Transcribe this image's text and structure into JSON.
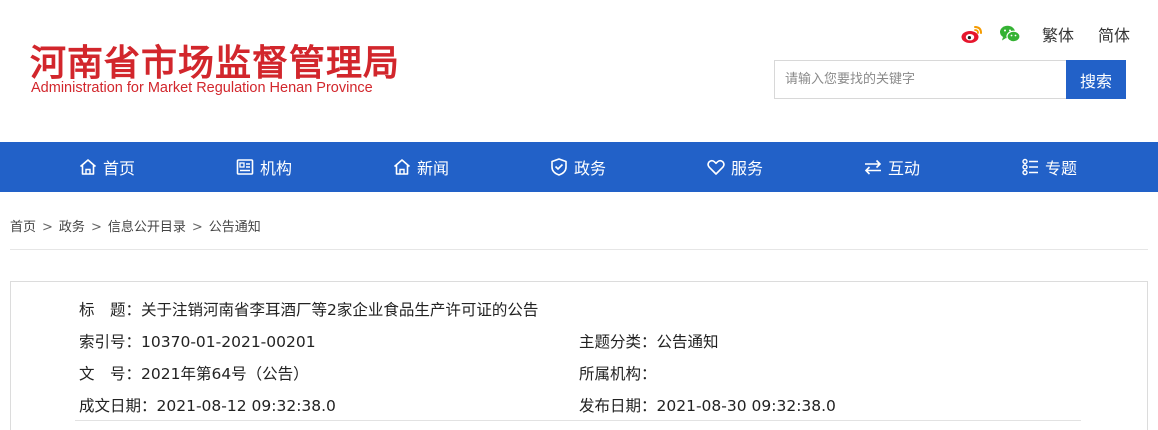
{
  "header": {
    "title": "河南省市场监督管理局",
    "subtitle": "Administration for Market Regulation Henan Province",
    "links": {
      "traditional": "繁体",
      "simplified": "简体"
    },
    "search": {
      "placeholder": "请输入您要找的关键字",
      "button": "搜索"
    },
    "icons": [
      "weibo-icon",
      "wechat-icon"
    ]
  },
  "colors": {
    "brand_red": "#d2262c",
    "nav_blue": "#2261c8"
  },
  "nav": {
    "items": [
      {
        "label": "首页",
        "icon": "home-icon"
      },
      {
        "label": "机构",
        "icon": "org-icon"
      },
      {
        "label": "新闻",
        "icon": "news-icon"
      },
      {
        "label": "政务",
        "icon": "gov-affairs-icon"
      },
      {
        "label": "服务",
        "icon": "heart-icon"
      },
      {
        "label": "互动",
        "icon": "interaction-icon"
      },
      {
        "label": "专题",
        "icon": "topic-icon"
      }
    ]
  },
  "breadcrumb": {
    "items": [
      "首页",
      "政务",
      "信息公开目录",
      "公告通知"
    ],
    "separator": ">"
  },
  "info": {
    "title_label": "标　题：",
    "title_value": "关于注销河南省李耳酒厂等2家企业食品生产许可证的公告",
    "index_label": "索引号：",
    "index_value": "10370-01-2021-00201",
    "topic_label": "主题分类：",
    "topic_value": "公告通知",
    "docno_label": "文　号：",
    "docno_value": "2021年第64号（公告）",
    "org_label": "所属机构：",
    "org_value": "",
    "created_label": "成文日期：",
    "created_value": "2021-08-12 09:32:38.0",
    "published_label": "发布日期：",
    "published_value": "2021-08-30 09:32:38.0"
  }
}
